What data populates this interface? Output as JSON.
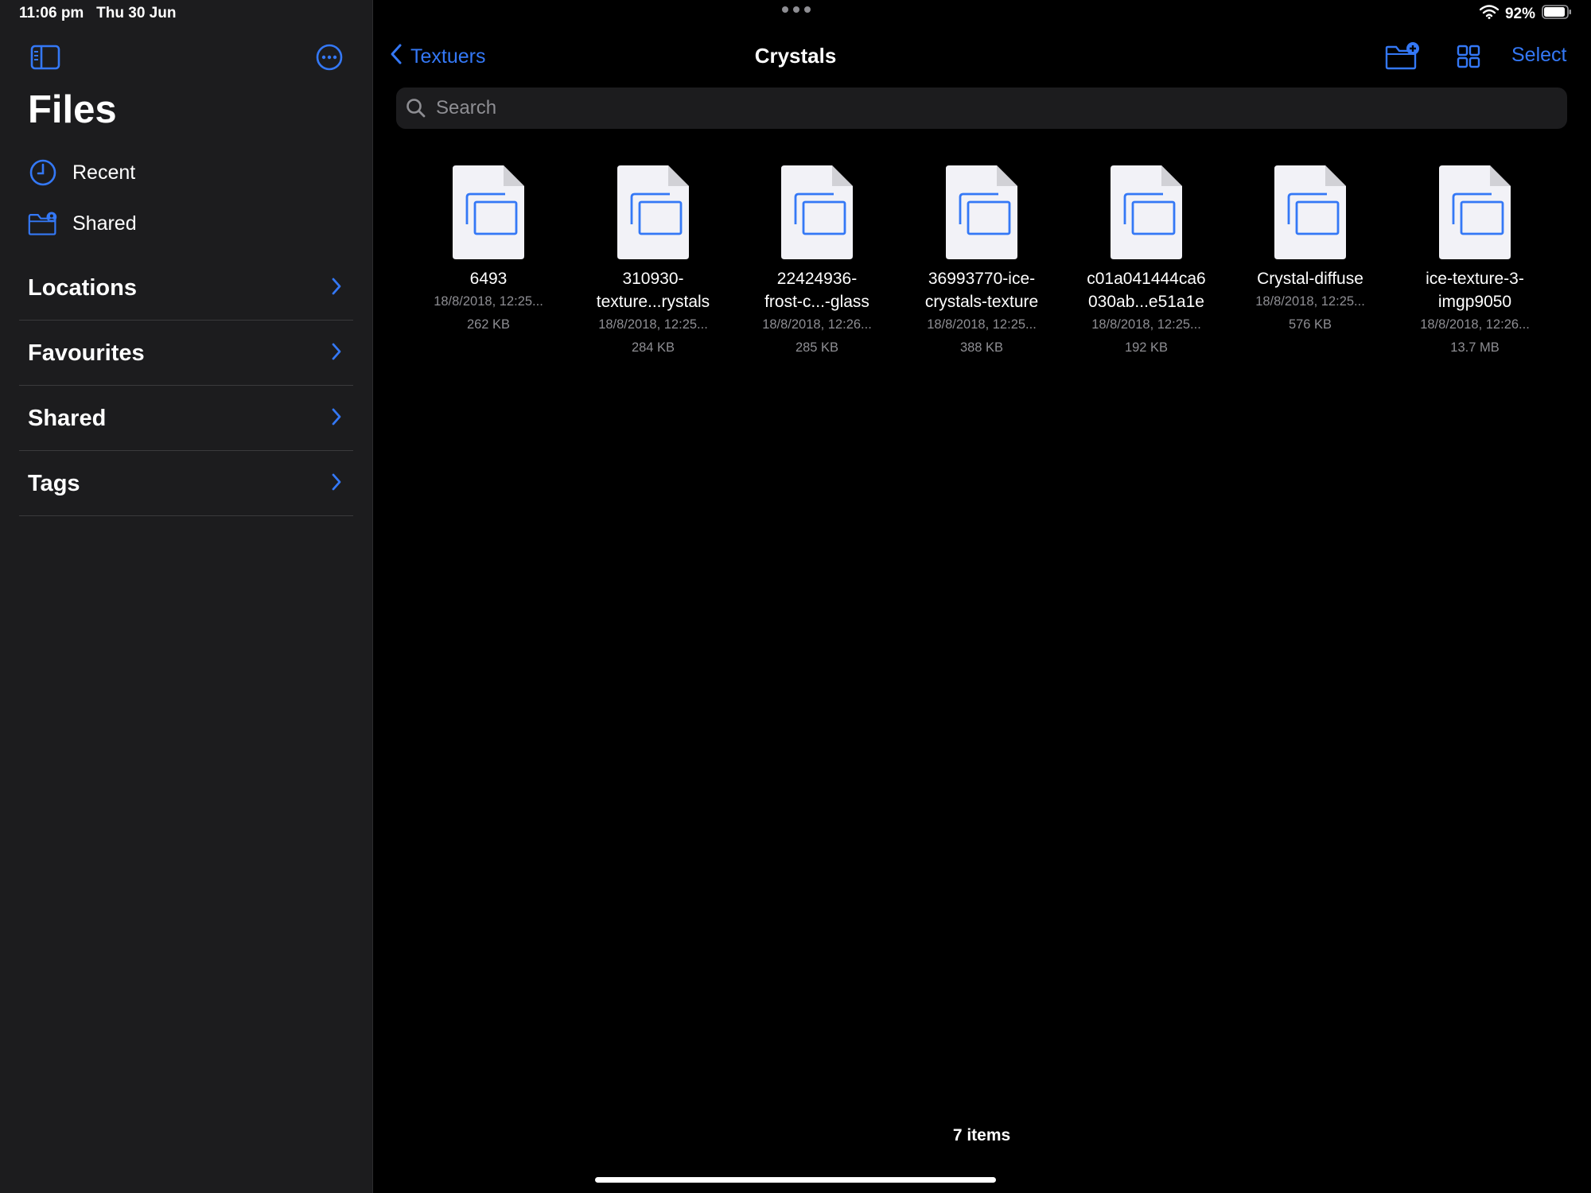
{
  "status_bar": {
    "time": "11:06 pm",
    "date": "Thu 30 Jun",
    "battery": "92%"
  },
  "sidebar": {
    "title": "Files",
    "quick_items": [
      {
        "label": "Recent",
        "icon": "clock-icon"
      },
      {
        "label": "Shared",
        "icon": "shared-folder-icon"
      }
    ],
    "sections": [
      {
        "label": "Locations"
      },
      {
        "label": "Favourites"
      },
      {
        "label": "Shared"
      },
      {
        "label": "Tags"
      }
    ]
  },
  "nav": {
    "back_label": "Textuers",
    "title": "Crystals",
    "select_label": "Select"
  },
  "search": {
    "placeholder": "Search"
  },
  "files": [
    {
      "name_line1": "6493",
      "name_line2": "",
      "date": "18/8/2018, 12:25...",
      "size": "262 KB"
    },
    {
      "name_line1": "310930-",
      "name_line2": "texture...rystals",
      "date": "18/8/2018, 12:25...",
      "size": "284 KB"
    },
    {
      "name_line1": "22424936-",
      "name_line2": "frost-c...-glass",
      "date": "18/8/2018, 12:26...",
      "size": "285 KB"
    },
    {
      "name_line1": "36993770-ice-",
      "name_line2": "crystals-texture",
      "date": "18/8/2018, 12:25...",
      "size": "388 KB"
    },
    {
      "name_line1": "c01a041444ca6",
      "name_line2": "030ab...e51a1e",
      "date": "18/8/2018, 12:25...",
      "size": "192 KB"
    },
    {
      "name_line1": "Crystal-diffuse",
      "name_line2": "",
      "date": "18/8/2018, 12:25...",
      "size": "576 KB"
    },
    {
      "name_line1": "ice-texture-3-",
      "name_line2": "imgp9050",
      "date": "18/8/2018, 12:26...",
      "size": "13.7 MB"
    }
  ],
  "footer": {
    "items_count": "7 items"
  },
  "colors": {
    "accent": "#3478f6",
    "sidebar_bg": "#1c1c1e",
    "main_bg": "#000000",
    "secondary_text": "#8e8e93"
  }
}
